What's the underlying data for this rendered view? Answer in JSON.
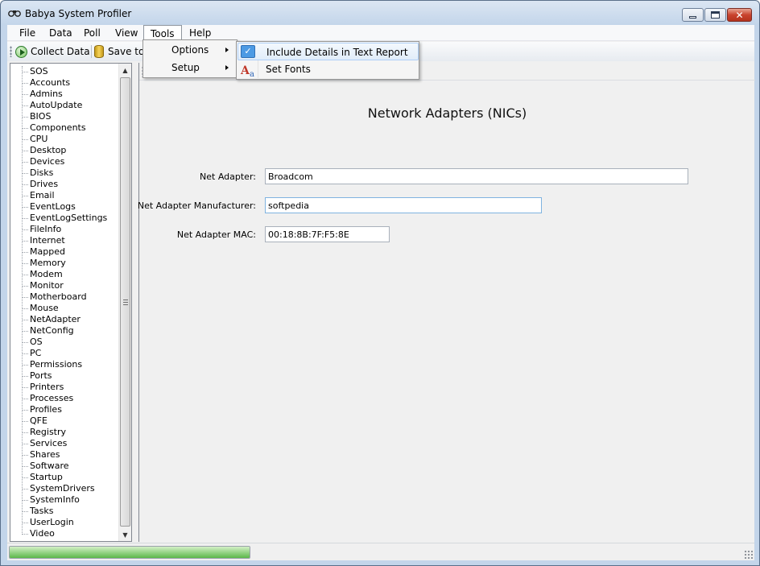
{
  "window": {
    "title": "Babya System Profiler",
    "min_glyph": "",
    "max_glyph": "",
    "close_glyph": "✕"
  },
  "menubar": {
    "items": [
      "File",
      "Data",
      "Poll",
      "View",
      "Tools",
      "Help"
    ],
    "open_menu": "Tools"
  },
  "toolbar": {
    "collect_label": "Collect Data",
    "save_label": "Save to"
  },
  "tools_menu": {
    "items": [
      {
        "label": "Options",
        "has_submenu": true
      },
      {
        "label": "Setup",
        "has_submenu": true
      }
    ]
  },
  "options_submenu": {
    "items": [
      {
        "label": "Include Details in Text Report",
        "checked": true,
        "icon": "check-icon"
      },
      {
        "label": "Set Fonts",
        "checked": false,
        "icon": "font-icon"
      }
    ]
  },
  "tree": {
    "items": [
      "SOS",
      "Accounts",
      "Admins",
      "AutoUpdate",
      "BIOS",
      "Components",
      "CPU",
      "Desktop",
      "Devices",
      "Disks",
      "Drives",
      "Email",
      "EventLogs",
      "EventLogSettings",
      "FileInfo",
      "Internet",
      "Mapped",
      "Memory",
      "Modem",
      "Monitor",
      "Motherboard",
      "Mouse",
      "NetAdapter",
      "NetConfig",
      "OS",
      "PC",
      "Permissions",
      "Ports",
      "Printers",
      "Processes",
      "Profiles",
      "QFE",
      "Registry",
      "Services",
      "Shares",
      "Software",
      "Startup",
      "SystemDrivers",
      "SystemInfo",
      "Tasks",
      "UserLogin",
      "Video"
    ]
  },
  "content": {
    "title": "Network Adapters (NICs)",
    "fields": [
      {
        "label": "Net Adapter:",
        "value": "Broadcom"
      },
      {
        "label": "Net Adapter Manufacturer:",
        "value": "softpedia"
      },
      {
        "label": "Net Adapter MAC:",
        "value": "00:18:8B:7F:F5:8E"
      }
    ]
  },
  "statusbar": {
    "progress_fraction": 1.0
  },
  "colors": {
    "titlebar": "#c3d5ea",
    "client_bg": "#f0f0f0",
    "menu_highlight": "#e1edfa",
    "check_accent": "#4c9ae4",
    "progress_green": "#5cb84a"
  }
}
